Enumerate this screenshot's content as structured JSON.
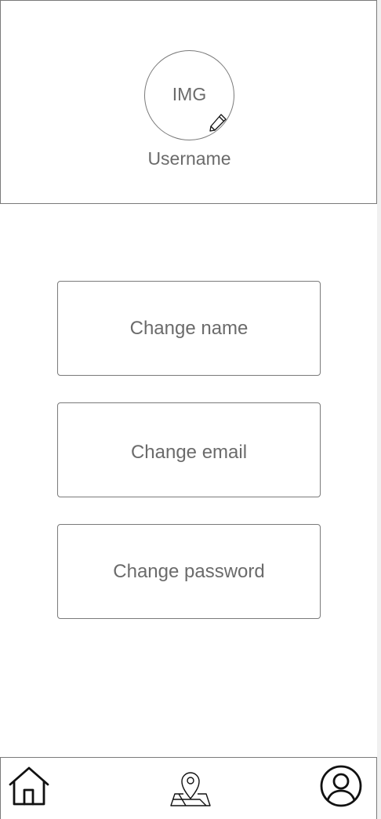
{
  "profile": {
    "avatar_placeholder": "IMG",
    "username": "Username",
    "edit_icon": "pencil-icon"
  },
  "actions": {
    "change_name": "Change name",
    "change_email": "Change email",
    "change_password": "Change password"
  },
  "bottom_nav": {
    "items": [
      {
        "icon": "home-icon"
      },
      {
        "icon": "map-pin-icon"
      },
      {
        "icon": "user-profile-icon"
      }
    ]
  },
  "colors": {
    "border": "#7a7a7a",
    "text": "#6b6b6b",
    "icon": "#111111"
  }
}
